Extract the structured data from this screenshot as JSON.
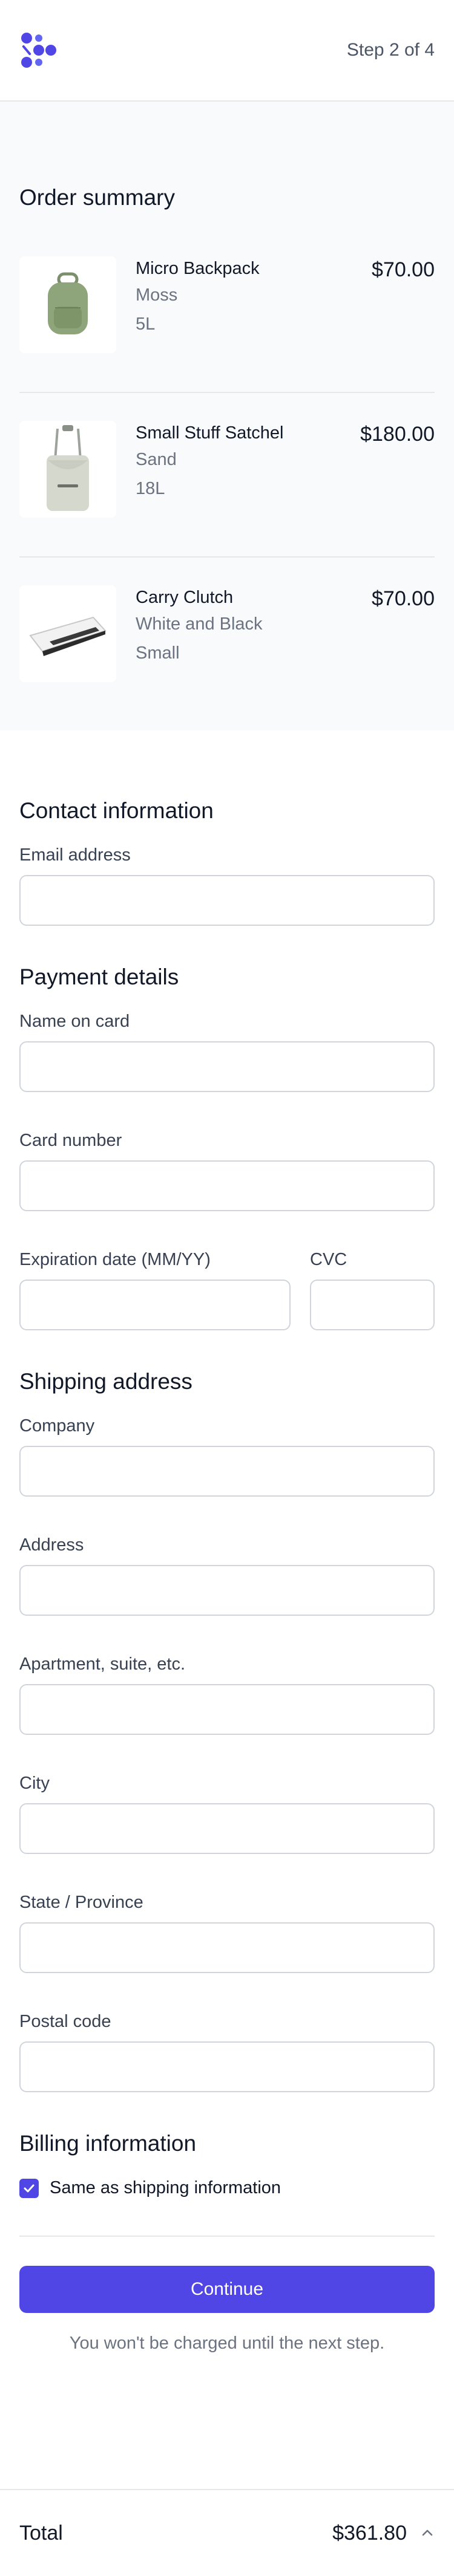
{
  "header": {
    "step_text": "Step 2 of 4"
  },
  "order_summary": {
    "title": "Order summary",
    "items": [
      {
        "name": "Micro Backpack",
        "color": "Moss",
        "size": "5L",
        "price": "$70.00",
        "icon": "backpack-image"
      },
      {
        "name": "Small Stuff Satchel",
        "color": "Sand",
        "size": "18L",
        "price": "$180.00",
        "icon": "satchel-image"
      },
      {
        "name": "Carry Clutch",
        "color": "White and Black",
        "size": "Small",
        "price": "$70.00",
        "icon": "clutch-image"
      }
    ]
  },
  "contact": {
    "title": "Contact information",
    "email_label": "Email address",
    "email_value": ""
  },
  "payment": {
    "title": "Payment details",
    "name_label": "Name on card",
    "card_label": "Card number",
    "expiration_label": "Expiration date (MM/YY)",
    "cvc_label": "CVC"
  },
  "shipping": {
    "title": "Shipping address",
    "company_label": "Company",
    "address_label": "Address",
    "apartment_label": "Apartment, suite, etc.",
    "city_label": "City",
    "state_label": "State / Province",
    "postal_label": "Postal code"
  },
  "billing": {
    "title": "Billing information",
    "same_as_shipping_label": "Same as shipping information",
    "same_as_shipping_checked": true
  },
  "actions": {
    "continue_label": "Continue",
    "note": "You won't be charged until the next step."
  },
  "total": {
    "label": "Total",
    "amount": "$361.80"
  },
  "colors": {
    "accent": "#4f46e5",
    "summary_bg": "#f9fafb",
    "border": "#e5e7eb"
  }
}
